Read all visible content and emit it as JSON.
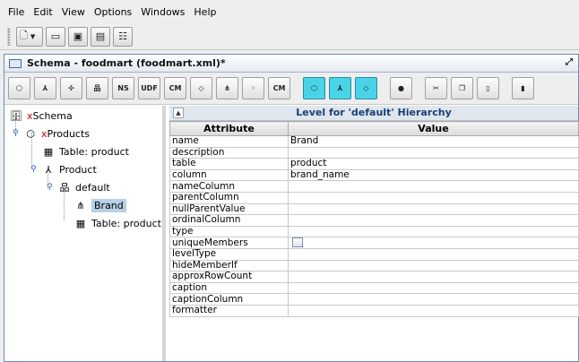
{
  "menu": [
    "File",
    "Edit",
    "View",
    "Options",
    "Windows",
    "Help"
  ],
  "frame": {
    "title": "Schema - foodmart (foodmart.xml)*"
  },
  "toolbar2": {
    "ns_label": "NS",
    "udf_label": "UDF",
    "cm_label": "CM",
    "cm2_label": "CM"
  },
  "tree": {
    "schema": {
      "prefix": "x",
      "label": "Schema"
    },
    "cube": {
      "prefix": "x",
      "label": "Products"
    },
    "cube_table": "Table: product",
    "dimension": "Product",
    "hierarchy": "default",
    "level": "Brand",
    "level_table": "Table: product"
  },
  "panel": {
    "header": "Level for 'default' Hierarchy",
    "col_attribute": "Attribute",
    "col_value": "Value"
  },
  "attributes": [
    {
      "name": "name",
      "value": "Brand"
    },
    {
      "name": "description",
      "value": ""
    },
    {
      "name": "table",
      "value": "product"
    },
    {
      "name": "column",
      "value": "brand_name"
    },
    {
      "name": "nameColumn",
      "value": ""
    },
    {
      "name": "parentColumn",
      "value": ""
    },
    {
      "name": "nullParentValue",
      "value": ""
    },
    {
      "name": "ordinalColumn",
      "value": ""
    },
    {
      "name": "type",
      "value": ""
    },
    {
      "name": "uniqueMembers",
      "value": "",
      "checkbox": true,
      "checked": false
    },
    {
      "name": "levelType",
      "value": ""
    },
    {
      "name": "hideMemberIf",
      "value": ""
    },
    {
      "name": "approxRowCount",
      "value": ""
    },
    {
      "name": "caption",
      "value": ""
    },
    {
      "name": "captionColumn",
      "value": ""
    },
    {
      "name": "formatter",
      "value": ""
    }
  ]
}
